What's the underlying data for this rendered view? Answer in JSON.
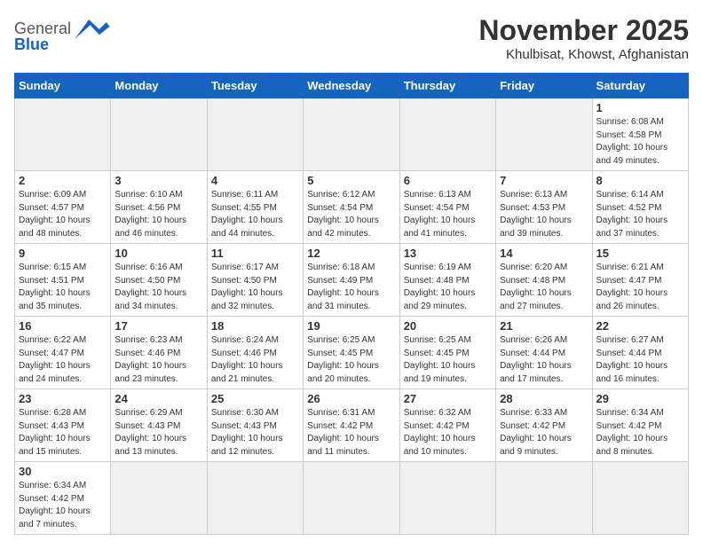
{
  "header": {
    "logo_general": "General",
    "logo_blue": "Blue",
    "month_title": "November 2025",
    "location": "Khulbisat, Khowst, Afghanistan"
  },
  "weekdays": [
    "Sunday",
    "Monday",
    "Tuesday",
    "Wednesday",
    "Thursday",
    "Friday",
    "Saturday"
  ],
  "weeks": [
    [
      {
        "day": "",
        "info": ""
      },
      {
        "day": "",
        "info": ""
      },
      {
        "day": "",
        "info": ""
      },
      {
        "day": "",
        "info": ""
      },
      {
        "day": "",
        "info": ""
      },
      {
        "day": "",
        "info": ""
      },
      {
        "day": "1",
        "info": "Sunrise: 6:08 AM\nSunset: 4:58 PM\nDaylight: 10 hours and 49 minutes."
      }
    ],
    [
      {
        "day": "2",
        "info": "Sunrise: 6:09 AM\nSunset: 4:57 PM\nDaylight: 10 hours and 48 minutes."
      },
      {
        "day": "3",
        "info": "Sunrise: 6:10 AM\nSunset: 4:56 PM\nDaylight: 10 hours and 46 minutes."
      },
      {
        "day": "4",
        "info": "Sunrise: 6:11 AM\nSunset: 4:55 PM\nDaylight: 10 hours and 44 minutes."
      },
      {
        "day": "5",
        "info": "Sunrise: 6:12 AM\nSunset: 4:54 PM\nDaylight: 10 hours and 42 minutes."
      },
      {
        "day": "6",
        "info": "Sunrise: 6:13 AM\nSunset: 4:54 PM\nDaylight: 10 hours and 41 minutes."
      },
      {
        "day": "7",
        "info": "Sunrise: 6:13 AM\nSunset: 4:53 PM\nDaylight: 10 hours and 39 minutes."
      },
      {
        "day": "8",
        "info": "Sunrise: 6:14 AM\nSunset: 4:52 PM\nDaylight: 10 hours and 37 minutes."
      }
    ],
    [
      {
        "day": "9",
        "info": "Sunrise: 6:15 AM\nSunset: 4:51 PM\nDaylight: 10 hours and 35 minutes."
      },
      {
        "day": "10",
        "info": "Sunrise: 6:16 AM\nSunset: 4:50 PM\nDaylight: 10 hours and 34 minutes."
      },
      {
        "day": "11",
        "info": "Sunrise: 6:17 AM\nSunset: 4:50 PM\nDaylight: 10 hours and 32 minutes."
      },
      {
        "day": "12",
        "info": "Sunrise: 6:18 AM\nSunset: 4:49 PM\nDaylight: 10 hours and 31 minutes."
      },
      {
        "day": "13",
        "info": "Sunrise: 6:19 AM\nSunset: 4:48 PM\nDaylight: 10 hours and 29 minutes."
      },
      {
        "day": "14",
        "info": "Sunrise: 6:20 AM\nSunset: 4:48 PM\nDaylight: 10 hours and 27 minutes."
      },
      {
        "day": "15",
        "info": "Sunrise: 6:21 AM\nSunset: 4:47 PM\nDaylight: 10 hours and 26 minutes."
      }
    ],
    [
      {
        "day": "16",
        "info": "Sunrise: 6:22 AM\nSunset: 4:47 PM\nDaylight: 10 hours and 24 minutes."
      },
      {
        "day": "17",
        "info": "Sunrise: 6:23 AM\nSunset: 4:46 PM\nDaylight: 10 hours and 23 minutes."
      },
      {
        "day": "18",
        "info": "Sunrise: 6:24 AM\nSunset: 4:46 PM\nDaylight: 10 hours and 21 minutes."
      },
      {
        "day": "19",
        "info": "Sunrise: 6:25 AM\nSunset: 4:45 PM\nDaylight: 10 hours and 20 minutes."
      },
      {
        "day": "20",
        "info": "Sunrise: 6:25 AM\nSunset: 4:45 PM\nDaylight: 10 hours and 19 minutes."
      },
      {
        "day": "21",
        "info": "Sunrise: 6:26 AM\nSunset: 4:44 PM\nDaylight: 10 hours and 17 minutes."
      },
      {
        "day": "22",
        "info": "Sunrise: 6:27 AM\nSunset: 4:44 PM\nDaylight: 10 hours and 16 minutes."
      }
    ],
    [
      {
        "day": "23",
        "info": "Sunrise: 6:28 AM\nSunset: 4:43 PM\nDaylight: 10 hours and 15 minutes."
      },
      {
        "day": "24",
        "info": "Sunrise: 6:29 AM\nSunset: 4:43 PM\nDaylight: 10 hours and 13 minutes."
      },
      {
        "day": "25",
        "info": "Sunrise: 6:30 AM\nSunset: 4:43 PM\nDaylight: 10 hours and 12 minutes."
      },
      {
        "day": "26",
        "info": "Sunrise: 6:31 AM\nSunset: 4:42 PM\nDaylight: 10 hours and 11 minutes."
      },
      {
        "day": "27",
        "info": "Sunrise: 6:32 AM\nSunset: 4:42 PM\nDaylight: 10 hours and 10 minutes."
      },
      {
        "day": "28",
        "info": "Sunrise: 6:33 AM\nSunset: 4:42 PM\nDaylight: 10 hours and 9 minutes."
      },
      {
        "day": "29",
        "info": "Sunrise: 6:34 AM\nSunset: 4:42 PM\nDaylight: 10 hours and 8 minutes."
      }
    ],
    [
      {
        "day": "30",
        "info": "Sunrise: 6:34 AM\nSunset: 4:42 PM\nDaylight: 10 hours and 7 minutes."
      },
      {
        "day": "",
        "info": ""
      },
      {
        "day": "",
        "info": ""
      },
      {
        "day": "",
        "info": ""
      },
      {
        "day": "",
        "info": ""
      },
      {
        "day": "",
        "info": ""
      },
      {
        "day": "",
        "info": ""
      }
    ]
  ]
}
